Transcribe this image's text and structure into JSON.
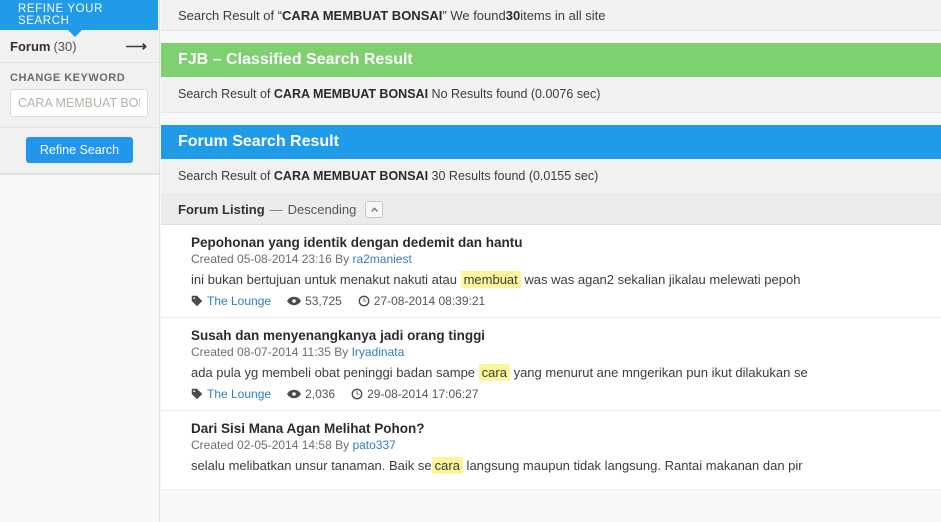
{
  "sidebar": {
    "tab_label": "REFINE YOUR SEARCH",
    "forum_label": "Forum",
    "forum_count": "(30)",
    "arrow_icon": "arrow-right-icon",
    "change_keyword_label": "CHANGE KEYWORD",
    "keyword_value": "",
    "keyword_placeholder": "CARA MEMBUAT BONSAI",
    "refine_button": "Refine Search"
  },
  "topbar": {
    "prefix": "Search Result of “",
    "query": "CARA MEMBUAT BONSAI",
    "middle": "” We found ",
    "count": "30",
    "suffix": " items in all site"
  },
  "fjb": {
    "heading": "FJB – Classified Search Result",
    "body_prefix": "Search Result of ",
    "body_query": "CARA MEMBUAT BONSAI",
    "body_suffix": " No Results found (0.0076 sec)"
  },
  "forum": {
    "heading": "Forum Search Result",
    "body_prefix": "Search Result of ",
    "body_query": "CARA MEMBUAT BONSAI",
    "body_suffix": " 30 Results found (0.0155 sec)"
  },
  "listing": {
    "title": "Forum Listing",
    "dash": "—",
    "direction": "Descending",
    "sort_icon": "chevron-up-icon"
  },
  "results": [
    {
      "title": "Pepohonan yang identik dengan dedemit dan hantu",
      "created_prefix": "Created 05-08-2014 23:16 By ",
      "author": "ra2maniest",
      "snippet_before": "ini bukan bertujuan untuk menakut nakuti atau ",
      "snippet_highlight": "membuat",
      "snippet_after": " was was agan2 sekalian jikalau melewati pepoh",
      "category": "The Lounge",
      "views": "53,725",
      "timestamp": "27-08-2014 08:39:21"
    },
    {
      "title": "Susah dan menyenangkanya jadi orang tinggi",
      "created_prefix": "Created 08-07-2014 11:35 By ",
      "author": "Iryadinata",
      "snippet_before": "ada pula yg membeli obat peninggi badan sampe ",
      "snippet_highlight": "cara",
      "snippet_after": " yang menurut ane mngerikan pun ikut dilakukan se",
      "category": "The Lounge",
      "views": "2,036",
      "timestamp": "29-08-2014 17:06:27"
    },
    {
      "title": "Dari Sisi Mana Agan Melihat Pohon?",
      "created_prefix": "Created 02-05-2014 14:58 By ",
      "author": "pato337",
      "snippet_before": "selalu melibatkan unsur tanaman. Baik se",
      "snippet_highlight": "cara",
      "snippet_after": " langsung maupun tidak langsung. Rantai makanan dan pir",
      "category": "",
      "views": "",
      "timestamp": ""
    }
  ],
  "colors": {
    "accent_blue": "#1f9be8",
    "accent_green": "#7ed070",
    "link_blue": "#2f7fc4",
    "highlight_yellow": "#fbf79a"
  }
}
